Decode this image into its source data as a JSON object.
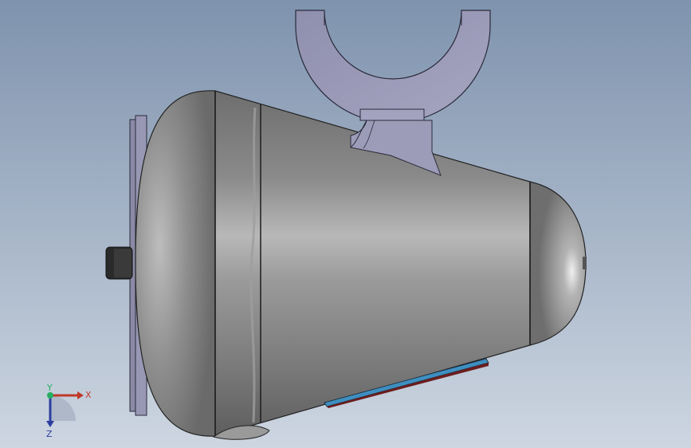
{
  "viewport": {
    "background_top": "#7f93ae",
    "background_bottom": "#cdd6e1"
  },
  "model": {
    "body_color": "#8c8c8c",
    "ring_color": "#9a9ab8",
    "accent_strip_color": "#3e8fc0",
    "connector_color": "#2a2a2a"
  },
  "triad": {
    "x_label": "X",
    "y_label": "Y",
    "z_label": "Z",
    "x_color": "#c0392b",
    "y_color": "#27ae60",
    "z_color": "#2c3e9e"
  }
}
